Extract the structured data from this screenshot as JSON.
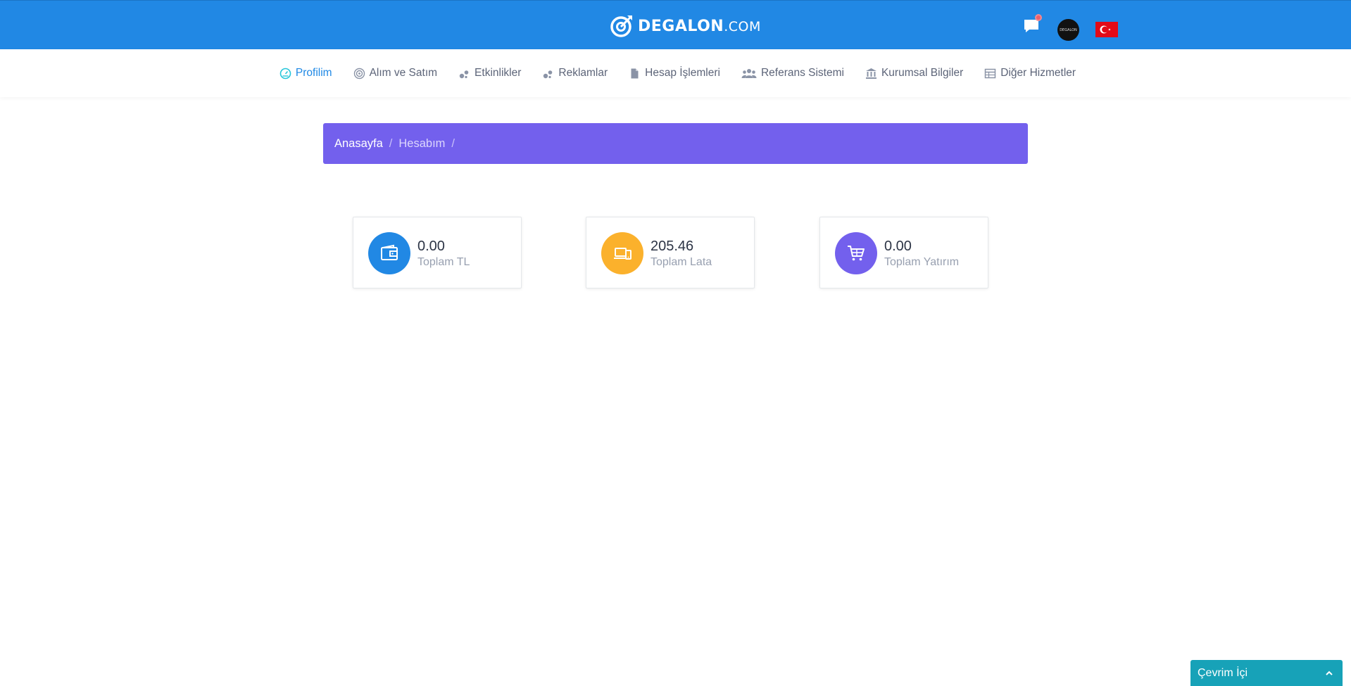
{
  "header": {
    "logo_text": "DEGALON",
    "logo_tld": ".COM",
    "avatar_text": "DEGALON",
    "flag": "turkey-flag"
  },
  "nav": {
    "items": [
      {
        "label": "Profilim",
        "icon": "speedometer-icon",
        "active": true
      },
      {
        "label": "Alım ve Satım",
        "icon": "target-icon"
      },
      {
        "label": "Etkinlikler",
        "icon": "bubbles-icon"
      },
      {
        "label": "Reklamlar",
        "icon": "bubbles-icon"
      },
      {
        "label": "Hesap İşlemleri",
        "icon": "file-icon"
      },
      {
        "label": "Referans Sistemi",
        "icon": "users-icon"
      },
      {
        "label": "Kurumsal Bilgiler",
        "icon": "bank-icon"
      },
      {
        "label": "Diğer Hizmetler",
        "icon": "table-icon"
      }
    ]
  },
  "breadcrumb": {
    "home": "Anasayfa",
    "current": "Hesabım",
    "separator": "/"
  },
  "stats": [
    {
      "value": "0.00",
      "label": "Toplam TL",
      "icon": "wallet-icon",
      "color": "#2188e4"
    },
    {
      "value": "205.46",
      "label": "Toplam Lata",
      "icon": "devices-icon",
      "color": "#fbb12c"
    },
    {
      "value": "0.00",
      "label": "Toplam Yatırım",
      "icon": "cart-icon",
      "color": "#7360ed"
    }
  ],
  "chat_widget": {
    "label": "Çevrim İçi",
    "icon": "chevron-up-icon"
  },
  "colors": {
    "topbar": "#2188e4",
    "breadcrumb": "#7360ed",
    "nav_active": "#1e88e5",
    "chat_widget": "#17a2b8"
  }
}
